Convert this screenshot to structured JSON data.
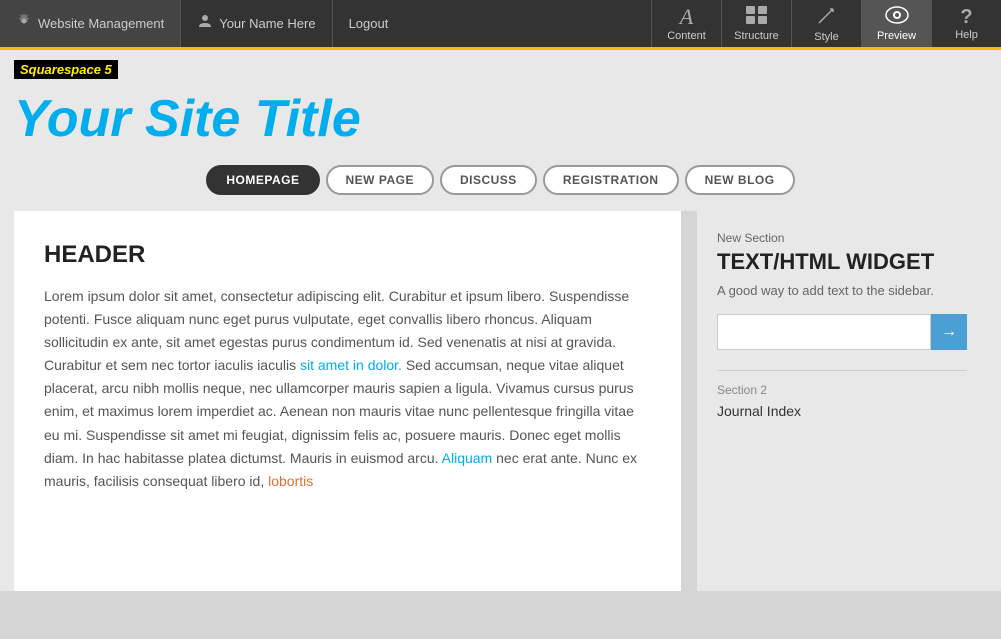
{
  "topbar": {
    "left_items": [
      {
        "id": "website-management",
        "icon": "gear",
        "label": "Website Management"
      },
      {
        "id": "user-name",
        "icon": "user",
        "label": "Your Name Here"
      },
      {
        "id": "logout",
        "icon": "",
        "label": "Logout"
      }
    ],
    "tools": [
      {
        "id": "content",
        "icon": "A",
        "label": "Content",
        "active": false
      },
      {
        "id": "structure",
        "icon": "grid",
        "label": "Structure",
        "active": false
      },
      {
        "id": "style",
        "icon": "pencil",
        "label": "Style",
        "active": false
      },
      {
        "id": "preview",
        "icon": "eye",
        "label": "Preview",
        "active": true
      },
      {
        "id": "help",
        "icon": "?",
        "label": "Help",
        "active": false
      }
    ]
  },
  "badge": {
    "text": "Squarespace 5"
  },
  "site_title": "Your Site Title",
  "nav": {
    "tabs": [
      {
        "id": "homepage",
        "label": "HOMEPAGE",
        "active": true
      },
      {
        "id": "new-page",
        "label": "NEW PAGE",
        "active": false
      },
      {
        "id": "discuss",
        "label": "DISCUSS",
        "active": false
      },
      {
        "id": "registration",
        "label": "REGISTRATION",
        "active": false
      },
      {
        "id": "new-blog",
        "label": "NEW BLOG",
        "active": false
      }
    ]
  },
  "main": {
    "header": "HEADER",
    "body_text": "Lorem ipsum dolor sit amet, consectetur adipiscing elit. Curabitur et ipsum libero. Suspendisse potenti. Fusce aliquam nunc eget purus vulputate, eget convallis libero rhoncus. Aliquam sollicitudin ex ante, sit amet egestas purus condimentum id. Sed venenatis at nisi at gravida. Curabitur et sem nec tortor iaculis iaculis sit amet in dolor. Sed accumsan, neque vitae aliquet placerat, arcu nibh mollis neque, nec ullamcorper mauris sapien a ligula. Vivamus cursus purus enim, et maximus lorem imperdiet ac. Aenean non mauris vitae nunc pellentesque fringilla vitae eu mi. Suspendisse sit amet mi feugiat, dignissim felis ac, posuere mauris. Donec eget mollis diam. In hac habitasse platea dictumst. Mauris in euismod arcu. Aliquam nec erat ante. Nunc ex mauris, facilisis consequat libero id, lobortis"
  },
  "sidebar": {
    "section1_label": "New Section",
    "widget_title": "TEXT/HTML WIDGET",
    "widget_desc": "A good way to add text to the sidebar.",
    "input_placeholder": "",
    "input_btn_icon": "→",
    "section2_label": "Section 2",
    "section2_link": "Journal Index"
  }
}
